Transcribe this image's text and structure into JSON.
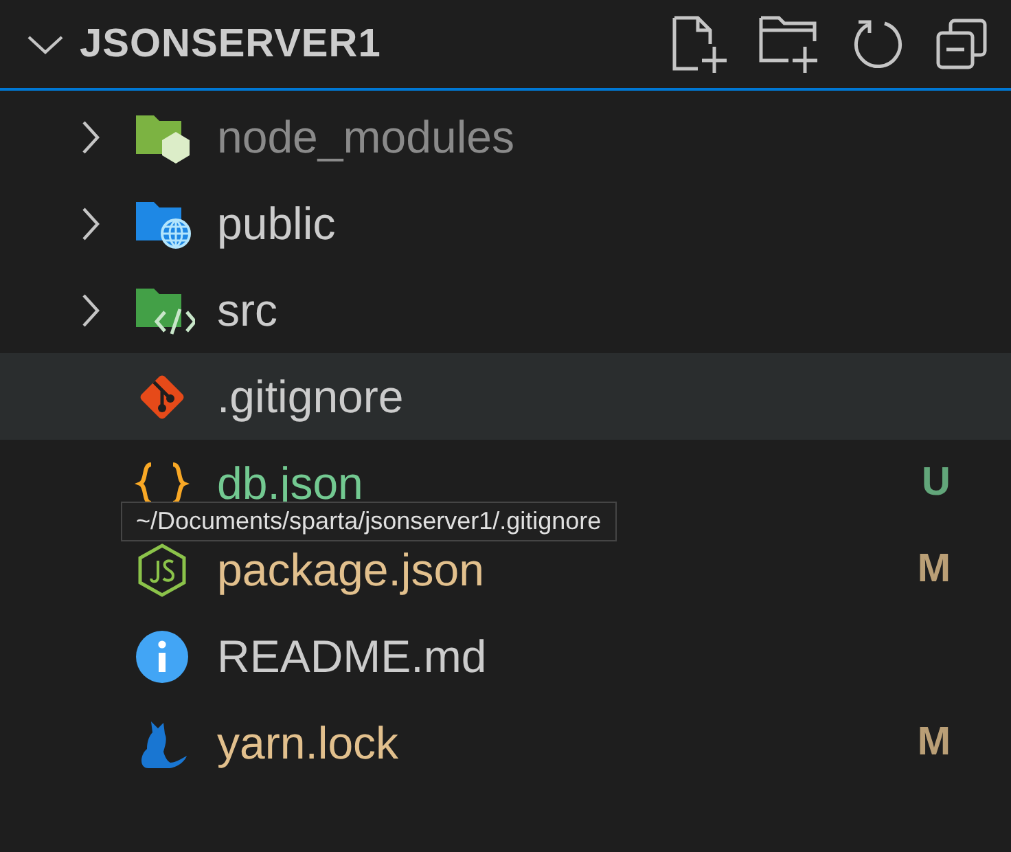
{
  "explorer": {
    "title": "JSONSERVER1",
    "expanded": true
  },
  "items": [
    {
      "name": "node_modules",
      "kind": "nodefolder",
      "expanded": false,
      "color": "#8a8a8a",
      "selected": false
    },
    {
      "name": "public",
      "kind": "webfolder",
      "expanded": false,
      "color": "#cccccc",
      "selected": false
    },
    {
      "name": "src",
      "kind": "srcfolder",
      "expanded": false,
      "color": "#cccccc",
      "selected": false
    },
    {
      "name": ".gitignore",
      "kind": "git",
      "color": "#cccccc",
      "selected": true
    },
    {
      "name": "db.json",
      "kind": "json",
      "color": "#73c991",
      "badge": "U",
      "selected": false
    },
    {
      "name": "package.json",
      "kind": "npm",
      "color": "#e2c08d",
      "badge": "M",
      "selected": false
    },
    {
      "name": "README.md",
      "kind": "info",
      "color": "#cccccc",
      "selected": false
    },
    {
      "name": "yarn.lock",
      "kind": "yarn",
      "color": "#e2c08d",
      "badge": "M",
      "selected": false
    }
  ],
  "tooltip": {
    "text": "~/Documents/sparta/jsonserver1/.gitignore"
  }
}
